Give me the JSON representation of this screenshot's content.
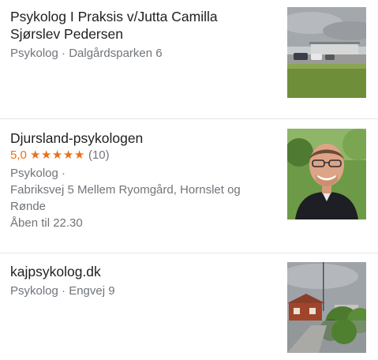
{
  "results": [
    {
      "name_line1": "Psykolog I Praksis v/Jutta Camilla",
      "name_line2": "Sjørslev Pedersen",
      "category_address": "Psykolog · Dalgårdsparken 6"
    },
    {
      "name": "Djursland-psykologen",
      "rating_value": "5,0",
      "stars": "★★★★★",
      "rating_count": "(10)",
      "category": "Psykolog ·",
      "address_line1": "Fabriksvej 5 Mellem Ryomgård, Hornslet og",
      "address_line2": "Rønde",
      "hours": "Åben til 22.30"
    },
    {
      "name": "kajpsykolog.dk",
      "category_address": "Psykolog · Engvej 9"
    }
  ],
  "colors": {
    "title": "#202124",
    "meta": "#70757a",
    "rating": "#e7711b",
    "divider": "#e6e6e6"
  },
  "icons": {
    "star": "star-icon"
  }
}
